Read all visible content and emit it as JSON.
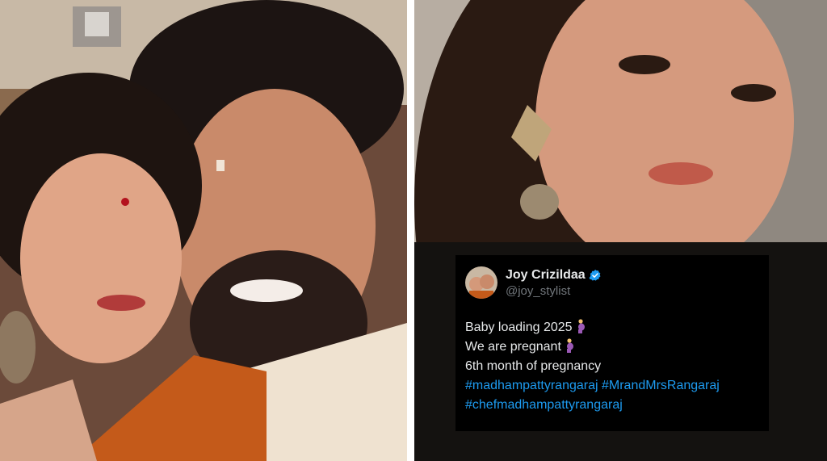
{
  "tweet": {
    "display_name": "Joy Crizildaa",
    "handle": "@joy_stylist",
    "lines": [
      "Baby loading  2025",
      "We are pregnant",
      "6th month of pregnancy"
    ],
    "hashtags_line1": "#madhampattyrangaraj #MrandMrsRangaraj",
    "hashtags_line2": "#chefmadhampattyrangaraj",
    "emoji": "pregnant-woman-emoji",
    "verified_color": "#1d9bf0",
    "hashtag_color": "#1d9bf0"
  },
  "photos": {
    "left": "couple-selfie-photo",
    "right": "woman-selfie-photo"
  }
}
